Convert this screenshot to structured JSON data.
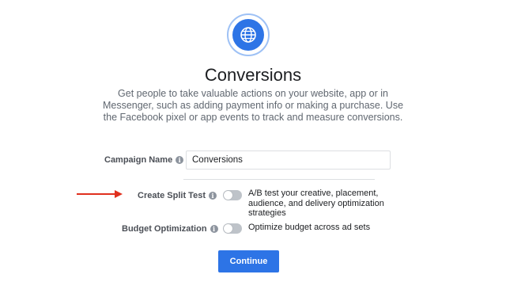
{
  "objective": {
    "icon": "globe-icon",
    "title": "Conversions",
    "description": "Get people to take valuable actions on your website, app or in Messenger, such as adding payment info or making a purchase. Use the Facebook pixel or app events to track and measure conversions."
  },
  "form": {
    "campaign_name_label": "Campaign Name",
    "campaign_name_value": "Conversions",
    "split_test_label": "Create Split Test",
    "split_test_description": "A/B test your creative, placement, audience, and delivery optimization strategies",
    "split_test_enabled": false,
    "budget_optimization_label": "Budget Optimization",
    "budget_optimization_description": "Optimize budget across ad sets",
    "budget_optimization_enabled": false,
    "info_glyph": "i"
  },
  "actions": {
    "continue_label": "Continue"
  },
  "colors": {
    "accent": "#2d74e6",
    "annotation_arrow": "#e0301e",
    "toggle_off": "#bec3c9"
  },
  "annotation": {
    "arrow_icon": "red-arrow-icon"
  }
}
